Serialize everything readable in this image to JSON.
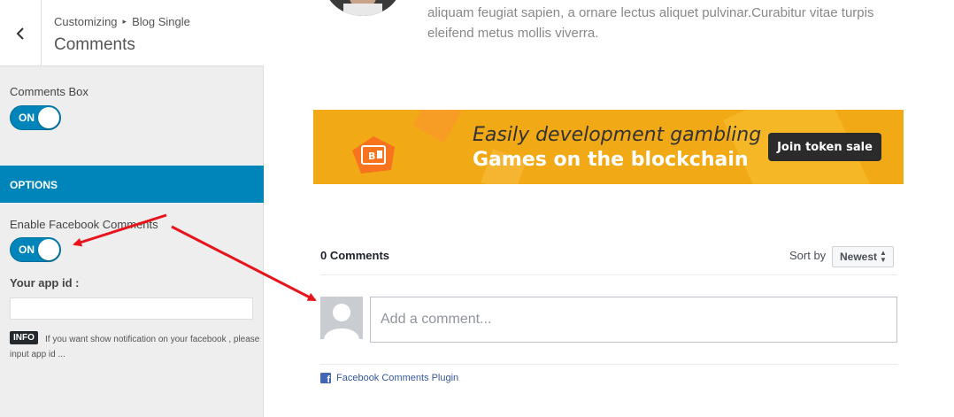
{
  "sidebar": {
    "breadcrumb": {
      "parent": "Customizing",
      "section": "Blog Single"
    },
    "title": "Comments",
    "comments_box": {
      "label": "Comments Box",
      "toggle": "ON"
    },
    "options_header": "OPTIONS",
    "facebook_comments": {
      "label": "Enable Facebook Comments",
      "toggle": "ON"
    },
    "app_id": {
      "label": "Your app id :",
      "value": ""
    },
    "info": {
      "badge": "INFO",
      "text": "If you want show notification on your facebook , please input app id ..."
    }
  },
  "preview": {
    "bio_text": "aliquam feugiat sapien, a ornare lectus aliquet pulvinar.Curabitur vitae turpis eleifend metus mollis viverra.",
    "banner": {
      "line1": "Easily development gambling",
      "line2": "Games on the blockchain",
      "button": "Join token sale"
    },
    "fb_comments": {
      "count_label": "0 Comments",
      "sort_label": "Sort by",
      "sort_value": "Newest",
      "placeholder": "Add a comment...",
      "plugin_label": "Facebook Comments Plugin"
    }
  },
  "colors": {
    "accent": "#0085ba",
    "annotation_arrow": "#e8141b",
    "banner_bg": "#f2a916"
  }
}
